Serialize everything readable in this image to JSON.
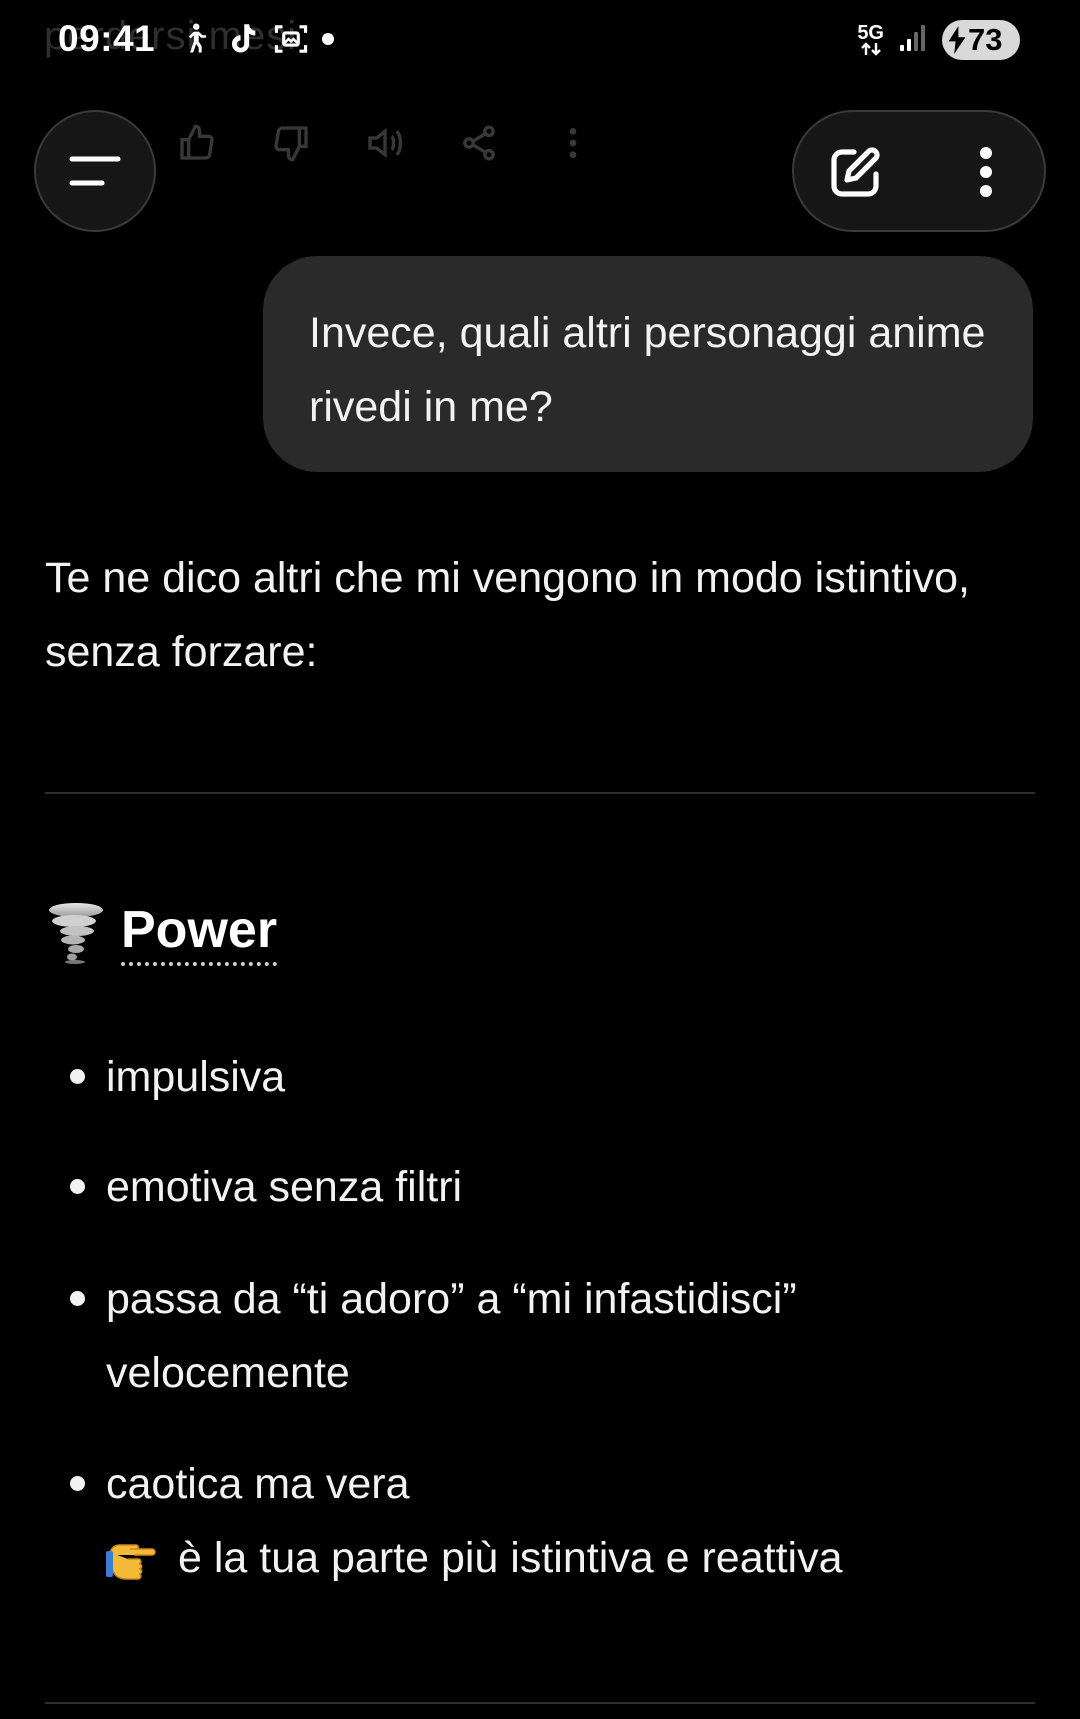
{
  "status_bar": {
    "time": "09:41",
    "network_type": "5G",
    "battery_level": "73",
    "icons": [
      "walking-icon",
      "tiktok-icon",
      "screenshot-icon",
      "notification-dot-icon",
      "signal-icon",
      "battery-charging-icon"
    ]
  },
  "ghost": {
    "partial_text": "perdersi mesi"
  },
  "header": {
    "menu_icon": "menu-icon",
    "compose_icon": "edit-icon",
    "more_icon": "more-vertical-icon"
  },
  "conversation": {
    "user_message": "Invece, quali altri personaggi anime rivedi in me?",
    "assistant_intro": "Te ne dico altri che mi vengono in modo istintivo, senza forzare:",
    "section": {
      "emoji": "tornado-icon",
      "title": "Power",
      "bullets": [
        "impulsiva",
        "emotiva senza filtri",
        "passa da “ti adoro” a “mi infastidisci” velocemente",
        "caotica ma vera"
      ],
      "takeaway_emoji": "pointing-hand-icon",
      "takeaway": "è la tua parte più istintiva e reattiva"
    }
  },
  "colors": {
    "background": "#000000",
    "text": "#f2f2f2",
    "bubble": "#2a2a2a",
    "button_bg": "#161616",
    "divider": "#2e2e2e"
  }
}
